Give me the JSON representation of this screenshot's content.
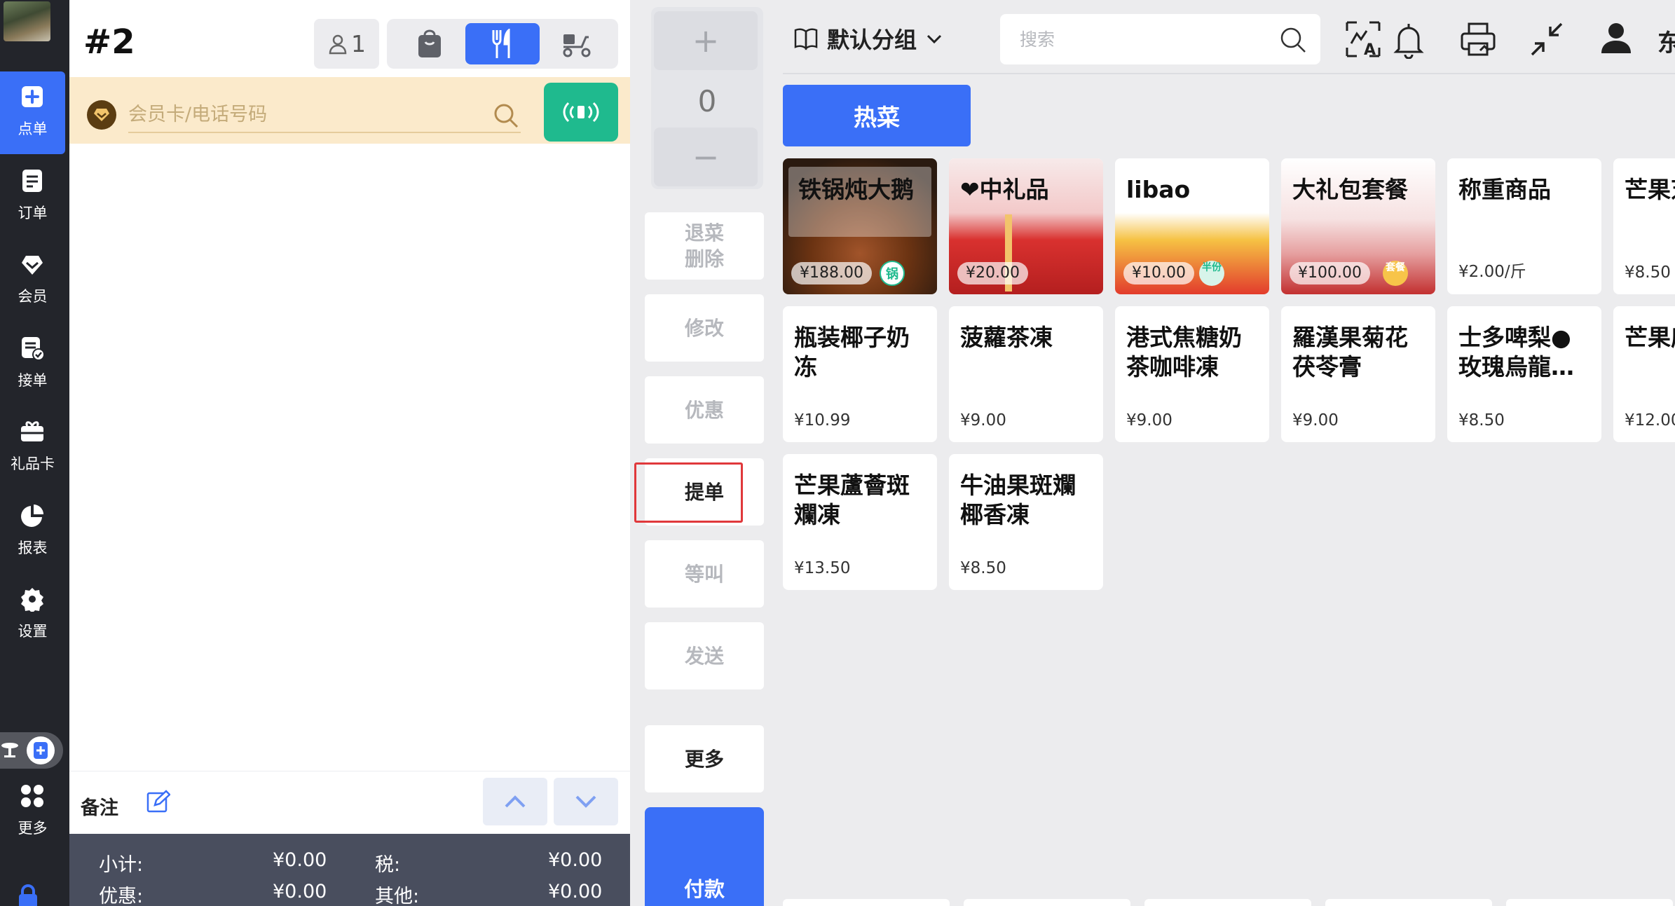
{
  "sidebar": {
    "items": [
      {
        "label": "点单",
        "icon": "add-order-icon",
        "active": true
      },
      {
        "label": "订单",
        "icon": "orders-icon"
      },
      {
        "label": "会员",
        "icon": "member-icon"
      },
      {
        "label": "接单",
        "icon": "accept-order-icon"
      },
      {
        "label": "礼品卡",
        "icon": "gift-card-icon"
      },
      {
        "label": "报表",
        "icon": "report-icon"
      },
      {
        "label": "设置",
        "icon": "settings-icon"
      },
      {
        "label": "更多",
        "icon": "more-icon"
      }
    ]
  },
  "order": {
    "number": "#2",
    "guests": "1",
    "member_placeholder": "会员卡/电话号码",
    "note_label": "备注",
    "totals": {
      "subtotal_label": "小计:",
      "subtotal": "¥0.00",
      "tax_label": "税:",
      "tax": "¥0.00",
      "discount_label": "优惠:",
      "discount": "¥0.00",
      "other_label": "其他:",
      "other": "¥0.00"
    }
  },
  "actions": {
    "plus": "+",
    "quantity": "0",
    "minus": "−",
    "void_line1": "退菜",
    "void_line2": "删除",
    "modify": "修改",
    "discount": "优惠",
    "submit": "提单",
    "hold": "等叫",
    "send": "发送",
    "more": "更多",
    "pay": "付款"
  },
  "menu": {
    "group": "默认分组",
    "search_placeholder": "搜索",
    "user_name": "东",
    "category": "热菜",
    "items": [
      {
        "name": "铁锅炖大鹅",
        "price": "¥188.00",
        "tag": "锅",
        "image": true
      },
      {
        "name": "❤中礼品",
        "price": "¥20.00",
        "image": true
      },
      {
        "name": "libao",
        "price": "¥10.00",
        "tag": "半份",
        "image": true
      },
      {
        "name": "大礼包套餐",
        "price": "¥100.00",
        "tag": "套餐",
        "image": true
      },
      {
        "name": "称重商品",
        "price": "¥2.00/斤"
      },
      {
        "name": "芒果芝",
        "price": "¥8.50"
      },
      {
        "name": "瓶装椰子奶冻",
        "price": "¥10.99"
      },
      {
        "name": "菠蘿茶凍",
        "price": "¥9.00"
      },
      {
        "name": "港式焦糖奶茶咖啡凍",
        "price": "¥9.00"
      },
      {
        "name": "羅漢果菊花茯苓膏",
        "price": "¥9.00"
      },
      {
        "name": "士多啤梨●玫瑰烏龍…",
        "price": "¥8.50"
      },
      {
        "name": "芒果庐",
        "price": "¥12.00"
      },
      {
        "name": "芒果蘆薈斑斕凍",
        "price": "¥13.50"
      },
      {
        "name": "牛油果斑斕椰香凍",
        "price": "¥8.50"
      }
    ]
  },
  "colors": {
    "accent": "#3a6ff7",
    "nfc": "#1fba8e",
    "highlight": "#e0383b",
    "sidebar": "#23252b"
  }
}
